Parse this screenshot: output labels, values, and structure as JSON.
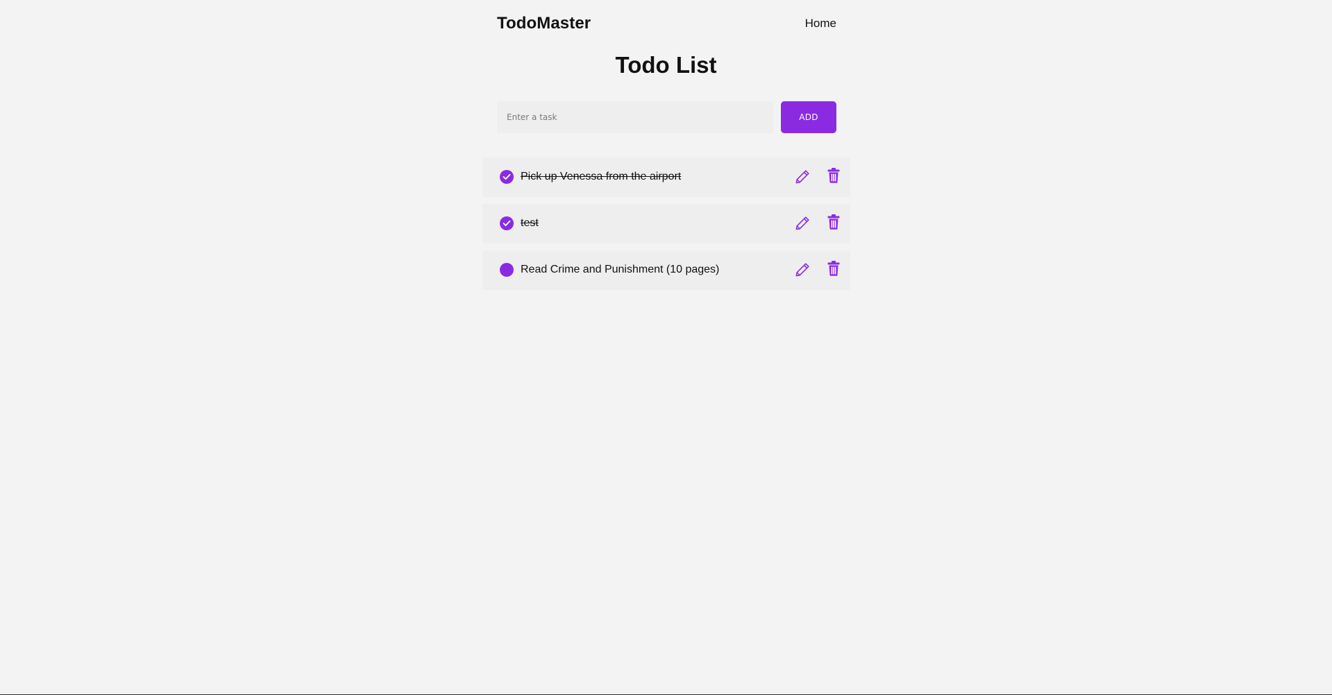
{
  "header": {
    "brand": "TodoMaster",
    "nav_home": "Home"
  },
  "page_title": "Todo List",
  "add_form": {
    "placeholder": "Enter a task",
    "value": "",
    "add_label": "ADD"
  },
  "todos": [
    {
      "text": "Pick up Venessa from the airport",
      "completed": true
    },
    {
      "text": "test",
      "completed": true
    },
    {
      "text": "Read Crime and Punishment (10 pages)",
      "completed": false
    }
  ],
  "icons": {
    "check": "check-icon",
    "edit": "pencil-icon",
    "delete": "trash-icon"
  },
  "colors": {
    "accent": "#8a2be2",
    "background": "#f3f3f3",
    "card": "#eeeeee"
  }
}
